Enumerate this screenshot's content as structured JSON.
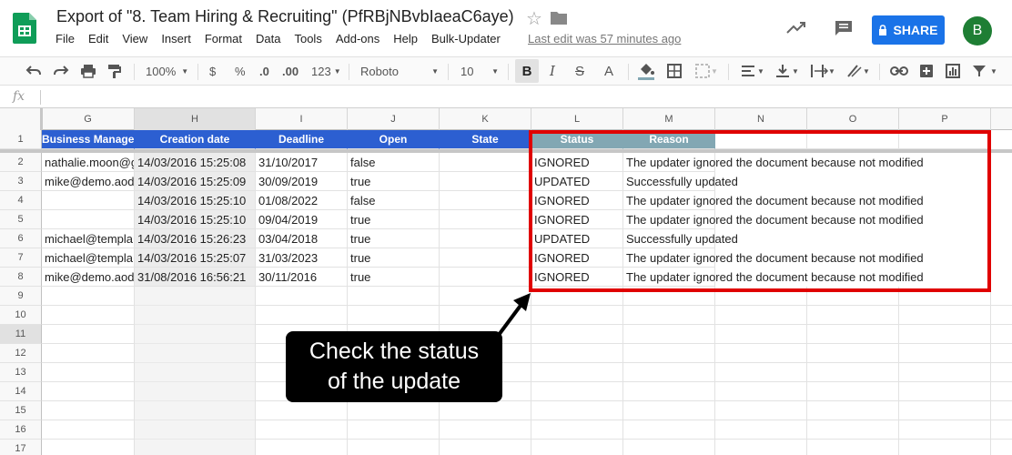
{
  "header": {
    "title": "Export of \"8. Team Hiring & Recruiting\" (PfRBjNBvbIaeaC6aye)",
    "menu": [
      "File",
      "Edit",
      "View",
      "Insert",
      "Format",
      "Data",
      "Tools",
      "Add-ons",
      "Help",
      "Bulk-Updater"
    ],
    "last_edit": "Last edit was 57 minutes ago",
    "share_label": "SHARE",
    "avatar_letter": "B"
  },
  "toolbar": {
    "zoom": "100%",
    "currency": "$",
    "percent": "%",
    "decimal_less": ".0",
    "decimal_more": ".00",
    "number_format": "123",
    "font": "Roboto",
    "font_size": "10",
    "bold": "B",
    "italic": "I",
    "strike": "S",
    "text_color": "A"
  },
  "formula_bar": {
    "fx": "fx",
    "value": ""
  },
  "columns": [
    "G",
    "H",
    "I",
    "J",
    "K",
    "L",
    "M",
    "N",
    "O",
    "P"
  ],
  "rows": [
    "1",
    "2",
    "3",
    "4",
    "5",
    "6",
    "7",
    "8",
    "9",
    "10",
    "11",
    "12",
    "13",
    "14",
    "15",
    "16",
    "17"
  ],
  "header_row": {
    "business_manager": "Business Manage",
    "creation_date": "Creation date",
    "deadline": "Deadline",
    "open": "Open",
    "state": "State",
    "status": "Status",
    "reason": "Reason"
  },
  "table": [
    {
      "g": "nathalie.moon@g",
      "h": "14/03/2016 15:25:08",
      "i": "31/10/2017",
      "j": "false",
      "k": "",
      "l": "IGNORED",
      "m": "The updater ignored the document because not modified"
    },
    {
      "g": "mike@demo.aod",
      "h": "14/03/2016 15:25:09",
      "i": "30/09/2019",
      "j": "true",
      "k": "",
      "l": "UPDATED",
      "m": "Successfully updated"
    },
    {
      "g": "",
      "h": "14/03/2016 15:25:10",
      "i": "01/08/2022",
      "j": "false",
      "k": "",
      "l": "IGNORED",
      "m": "The updater ignored the document because not modified"
    },
    {
      "g": "",
      "h": "14/03/2016 15:25:10",
      "i": "09/04/2019",
      "j": "true",
      "k": "",
      "l": "IGNORED",
      "m": "The updater ignored the document because not modified"
    },
    {
      "g": "michael@templa",
      "h": "14/03/2016 15:26:23",
      "i": "03/04/2018",
      "j": "true",
      "k": "",
      "l": "UPDATED",
      "m": "Successfully updated"
    },
    {
      "g": "michael@templa",
      "h": "14/03/2016 15:25:07",
      "i": "31/03/2023",
      "j": "true",
      "k": "",
      "l": "IGNORED",
      "m": "The updater ignored the document because not modified"
    },
    {
      "g": "mike@demo.aod",
      "h": "31/08/2016 16:56:21",
      "i": "30/11/2016",
      "j": "true",
      "k": "",
      "l": "IGNORED",
      "m": "The updater ignored the document because not modified"
    }
  ],
  "callout": {
    "line1": "Check the status",
    "line2": "of the update"
  },
  "colors": {
    "header_blue": "#2c5fd1",
    "header_teal": "#82a7b3",
    "highlight_red": "#e00000",
    "share_blue": "#1a73e8",
    "avatar_green": "#1e7e34"
  }
}
